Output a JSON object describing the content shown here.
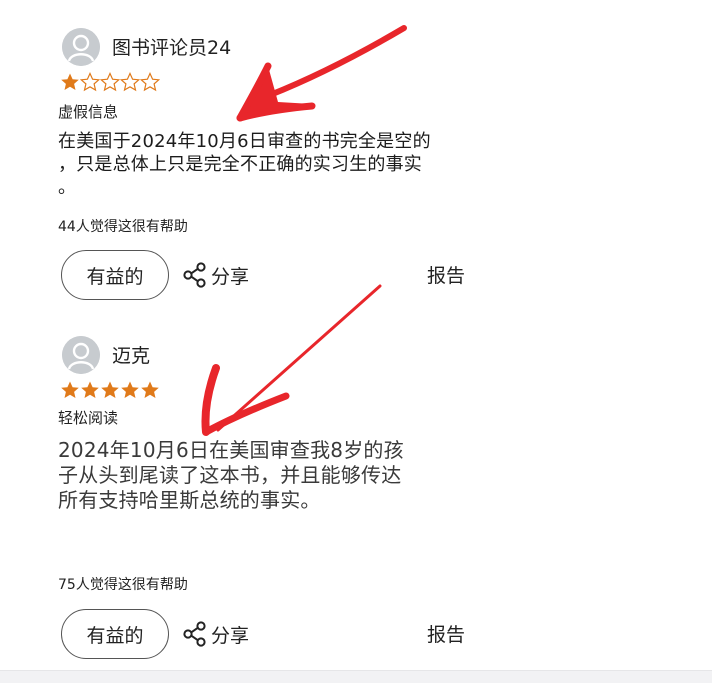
{
  "reviews": [
    {
      "username": "图书评论员24",
      "rating": 1,
      "max_rating": 5,
      "tag": "虚假信息",
      "text": "在美国于2024年10月6日审查的书完全是空的\n，只是总体上只是完全不正确的实习生的事实\n。",
      "helpful_count": "44人觉得这很有帮助",
      "helpful_label": "有益的",
      "share_label": "分享",
      "report_label": "报告"
    },
    {
      "username": "迈克",
      "rating": 5,
      "max_rating": 5,
      "tag": "轻松阅读",
      "text": "2024年10月6日在美国审查我8岁的孩\n子从头到尾读了这本书，并且能够传达\n所有支持哈里斯总统的事实。",
      "helpful_count": "75人觉得这很有帮助",
      "helpful_label": "有益的",
      "share_label": "分享",
      "report_label": "报告"
    }
  ],
  "colors": {
    "star_filled": "#e07a1a",
    "star_empty": "#e07a1a",
    "annotation_arrow": "#e8262b",
    "avatar_bg": "#c7cbcf"
  },
  "icons": {
    "avatar": "user-avatar-icon",
    "share": "share-icon",
    "star": "star-icon"
  }
}
